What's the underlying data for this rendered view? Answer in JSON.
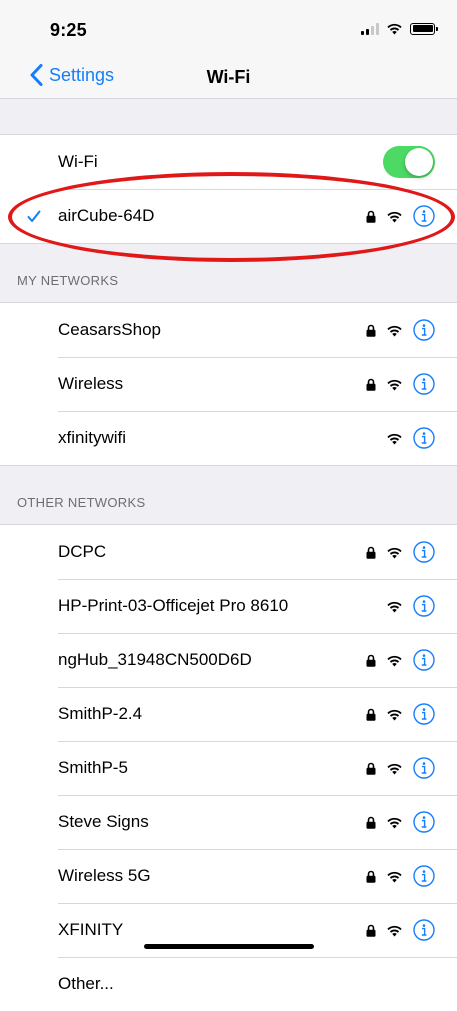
{
  "status_bar": {
    "time": "9:25"
  },
  "nav": {
    "back_label": "Settings",
    "title": "Wi-Fi"
  },
  "wifi_toggle": {
    "label": "Wi-Fi",
    "on": true
  },
  "connected": {
    "name": "airCube-64D",
    "secured": true
  },
  "my_networks": {
    "header": "MY NETWORKS",
    "items": [
      {
        "name": "CeasarsShop",
        "secured": true
      },
      {
        "name": "Wireless",
        "secured": true
      },
      {
        "name": "xfinitywifi",
        "secured": false
      }
    ]
  },
  "other_networks": {
    "header": "OTHER NETWORKS",
    "items": [
      {
        "name": "DCPC",
        "secured": true
      },
      {
        "name": "HP-Print-03-Officejet Pro 8610",
        "secured": false
      },
      {
        "name": "ngHub_31948CN500D6D",
        "secured": true
      },
      {
        "name": "SmithP-2.4",
        "secured": true
      },
      {
        "name": "SmithP-5",
        "secured": true
      },
      {
        "name": "Steve Signs",
        "secured": true
      },
      {
        "name": "Wireless 5G",
        "secured": true
      },
      {
        "name": "XFINITY",
        "secured": true
      },
      {
        "name": "Other..."
      }
    ]
  },
  "colors": {
    "accent": "#147efb",
    "toggle_on": "#4cd964",
    "annotation": "#e01818",
    "background": "#efeff4"
  },
  "icons": [
    "chevron-left-icon",
    "checkmark-icon",
    "lock-icon",
    "wifi-icon",
    "info-icon",
    "signal-icon",
    "battery-icon"
  ]
}
